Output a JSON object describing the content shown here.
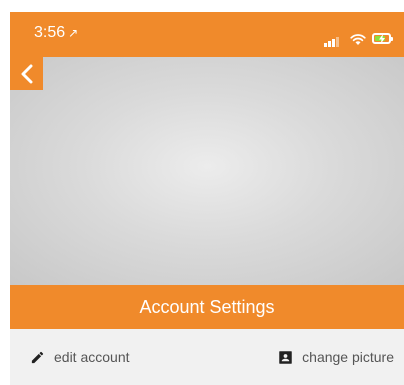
{
  "status_bar": {
    "time": "3:56",
    "location_glyph": "↗",
    "signal_icon": "cellular-signal-icon",
    "wifi_icon": "wifi-icon",
    "battery_icon": "battery-charging-icon",
    "battery_level": 0.8
  },
  "nav": {
    "back_icon": "chevron-left-icon"
  },
  "header": {
    "title": "Account Settings"
  },
  "actions": {
    "edit": {
      "label": "edit account",
      "icon": "pencil-icon"
    },
    "picture": {
      "label": "change picture",
      "icon": "contact-card-icon"
    }
  },
  "colors": {
    "accent": "#f08a2b",
    "background": "#f1f1f1",
    "text": "#555555"
  }
}
